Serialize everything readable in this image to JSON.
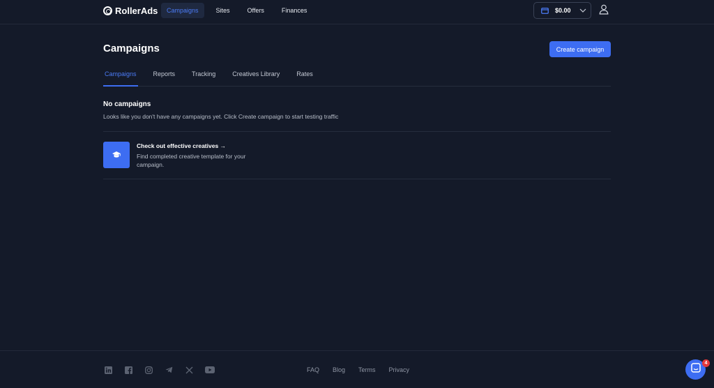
{
  "brand": {
    "name": "RollerAds"
  },
  "nav": {
    "items": [
      {
        "label": "Campaigns",
        "active": true
      },
      {
        "label": "Sites",
        "active": false
      },
      {
        "label": "Offers",
        "active": false
      },
      {
        "label": "Finances",
        "active": false
      }
    ]
  },
  "header": {
    "balance": "$0.00",
    "wallet_icon": "wallet-icon",
    "chevron_icon": "chevron-down-icon",
    "user_icon": "user-icon"
  },
  "page": {
    "title": "Campaigns",
    "create_button": "Create campaign"
  },
  "tabs": [
    {
      "label": "Campaigns",
      "active": true
    },
    {
      "label": "Reports",
      "active": false
    },
    {
      "label": "Tracking",
      "active": false
    },
    {
      "label": "Creatives Library",
      "active": false
    },
    {
      "label": "Rates",
      "active": false
    }
  ],
  "empty_state": {
    "title": "No campaigns",
    "description": "Looks like you don't have any campaigns yet. Click Create campaign to start testing traffic"
  },
  "promo": {
    "icon": "graduation-cap-icon",
    "title": "Check out effective creatives →",
    "description": "Find completed creative template for your campaign."
  },
  "footer": {
    "socials": [
      "linkedin-icon",
      "facebook-icon",
      "instagram-icon",
      "telegram-icon",
      "x-icon",
      "youtube-icon"
    ],
    "links": [
      "FAQ",
      "Blog",
      "Terms",
      "Privacy"
    ]
  },
  "chat": {
    "icon": "chat-icon",
    "badge_count": "4"
  },
  "colors": {
    "background": "#141a29",
    "accent": "#3d6df2",
    "active_text": "#4b7bf5",
    "badge": "#e5393a"
  }
}
